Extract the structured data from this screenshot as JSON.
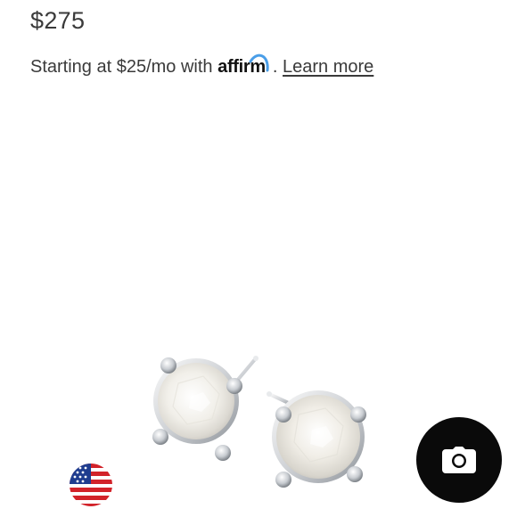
{
  "product": {
    "price": "$275"
  },
  "financing": {
    "prefix": "Starting at $25/mo with",
    "provider_logo_text": "affirm",
    "separator": ".",
    "learn_more_label": "Learn more",
    "provider_accent_color": "#4a9ee8"
  },
  "image": {
    "icon": "pearl-stud-earrings-image"
  },
  "badges": {
    "flag_icon": "us-flag-icon"
  },
  "actions": {
    "camera_icon": "camera-icon"
  },
  "colors": {
    "text": "#3a3a3a",
    "button_bg": "#0a0a0a"
  }
}
